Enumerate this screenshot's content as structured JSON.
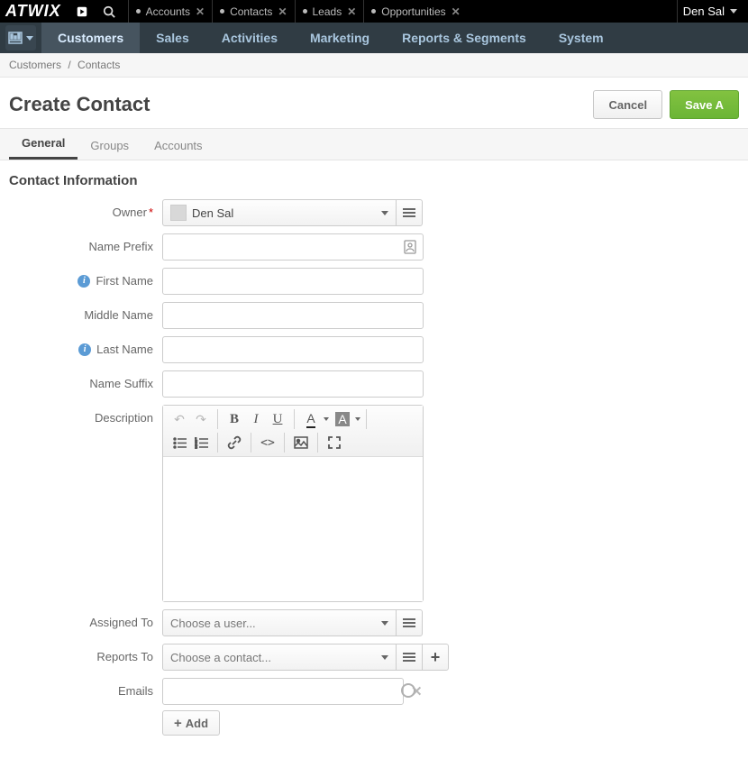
{
  "topbar": {
    "logo": "ATWIX",
    "pinned": [
      {
        "label": "Accounts"
      },
      {
        "label": "Contacts"
      },
      {
        "label": "Leads"
      },
      {
        "label": "Opportunities"
      }
    ],
    "user": "Den Sal"
  },
  "mainnav": {
    "items": [
      {
        "label": "Customers",
        "active": true
      },
      {
        "label": "Sales"
      },
      {
        "label": "Activities"
      },
      {
        "label": "Marketing"
      },
      {
        "label": "Reports & Segments"
      },
      {
        "label": "System"
      }
    ]
  },
  "breadcrumb": {
    "parent": "Customers",
    "current": "Contacts"
  },
  "page": {
    "title": "Create Contact",
    "cancel": "Cancel",
    "save": "Save A"
  },
  "tabs": [
    {
      "label": "General",
      "active": true
    },
    {
      "label": "Groups"
    },
    {
      "label": "Accounts"
    }
  ],
  "section": {
    "heading": "Contact Information"
  },
  "form": {
    "owner": {
      "label": "Owner",
      "value": "Den Sal",
      "required": true
    },
    "name_prefix": {
      "label": "Name Prefix",
      "value": ""
    },
    "first_name": {
      "label": "First Name",
      "value": "",
      "info": true
    },
    "middle_name": {
      "label": "Middle Name",
      "value": ""
    },
    "last_name": {
      "label": "Last Name",
      "value": "",
      "info": true
    },
    "name_suffix": {
      "label": "Name Suffix",
      "value": ""
    },
    "description": {
      "label": "Description"
    },
    "assigned_to": {
      "label": "Assigned To",
      "placeholder": "Choose a user..."
    },
    "reports_to": {
      "label": "Reports To",
      "placeholder": "Choose a contact..."
    },
    "emails": {
      "label": "Emails",
      "value": "",
      "add_label": "Add"
    }
  },
  "editor": {
    "buttons": {
      "undo": "↶",
      "redo": "↷",
      "bold": "B",
      "italic": "I",
      "underline": "U",
      "textcolor": "A",
      "bgcolor": "A",
      "ul": "list",
      "ol": "olist",
      "link": "link",
      "code": "<>",
      "image": "img",
      "fullscreen": "fs"
    }
  }
}
